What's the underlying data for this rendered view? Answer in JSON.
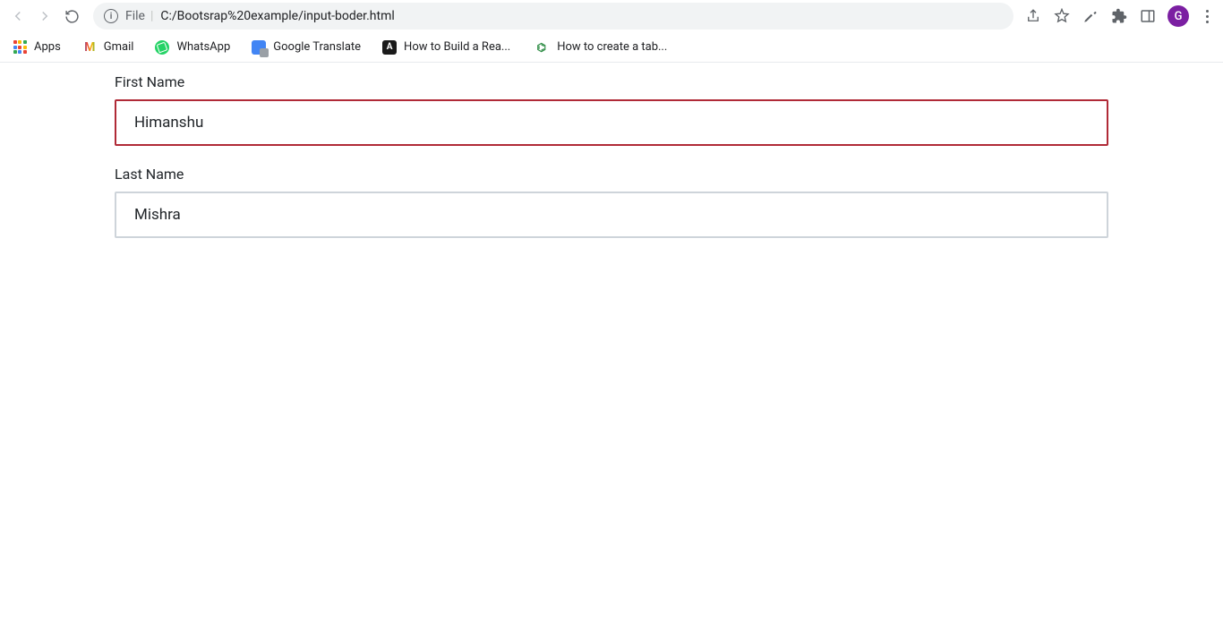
{
  "browser": {
    "url_scheme_label": "File",
    "url_path": "C:/Bootsrap%20example/input-boder.html",
    "profile_initial": "G"
  },
  "bookmarks": {
    "apps_label": "Apps",
    "items": [
      {
        "label": "Gmail"
      },
      {
        "label": "WhatsApp"
      },
      {
        "label": "Google Translate"
      },
      {
        "label": "How to Build a Rea..."
      },
      {
        "label": "How to create a tab..."
      }
    ]
  },
  "form": {
    "first_name_label": "First Name",
    "first_name_value": "Himanshu",
    "last_name_label": "Last Name",
    "last_name_value": "Mishra"
  }
}
